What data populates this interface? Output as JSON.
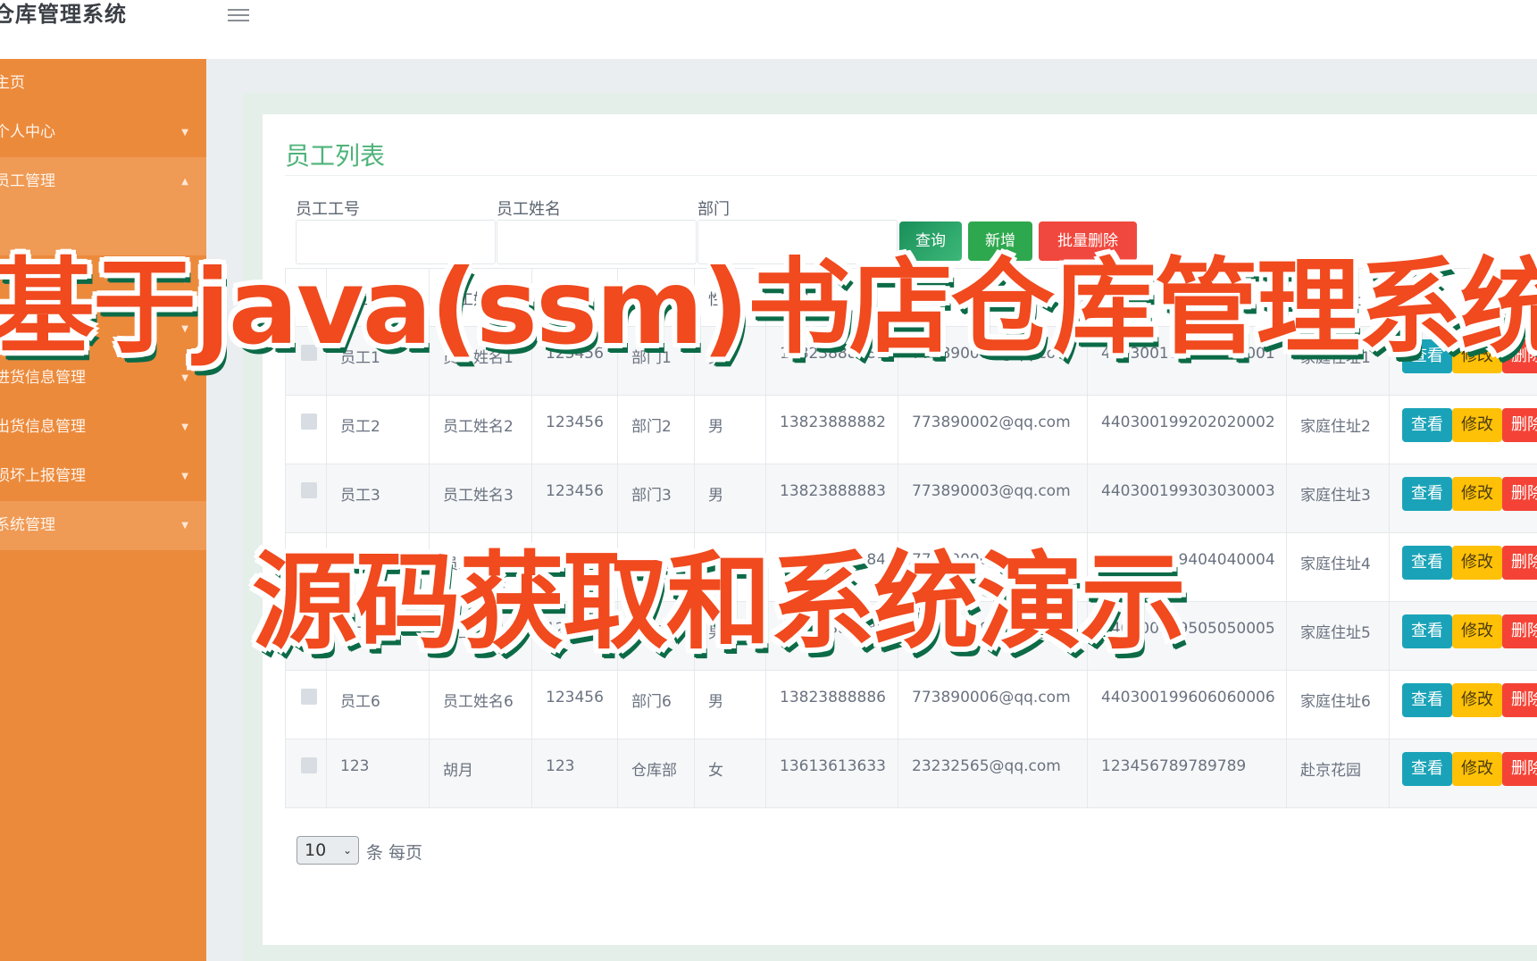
{
  "app": {
    "title": "仓库管理系统",
    "menu_icon": "hamburger-icon"
  },
  "sidebar": {
    "items": [
      {
        "label": "主页",
        "caret": ""
      },
      {
        "label": "个人中心",
        "caret": "▼"
      },
      {
        "label": "员工管理",
        "caret": "▲",
        "active": true
      },
      {
        "label": "",
        "caret": ""
      },
      {
        "label": "",
        "caret": "▼"
      },
      {
        "label": "供应商管理",
        "caret": "▼"
      },
      {
        "label": "进货信息管理",
        "caret": "▼"
      },
      {
        "label": "出货信息管理",
        "caret": "▼"
      },
      {
        "label": "损坏上报管理",
        "caret": "▼"
      },
      {
        "label": "系统管理",
        "caret": "▼"
      }
    ]
  },
  "page": {
    "title": "员工列表",
    "search": {
      "fields": [
        {
          "label": "员工工号",
          "value": "",
          "placeholder": ""
        },
        {
          "label": "员工姓名",
          "value": "",
          "placeholder": ""
        },
        {
          "label": "部门",
          "value": "",
          "placeholder": ""
        }
      ],
      "search_label": "查询",
      "add_label": "新增",
      "batch_delete_label": "批量删除"
    },
    "table": {
      "columns": [
        "",
        "员工工号",
        "员工姓名",
        "密码",
        "部门",
        "性别",
        "手机",
        "邮箱",
        "身份证",
        "家庭住址",
        "操作"
      ],
      "rows": [
        [
          "员工1",
          "员工姓名1",
          "123456",
          "部门1",
          "男",
          "13823888881",
          "773890001@qq.com",
          "440300199101010001",
          "家庭住址1"
        ],
        [
          "员工2",
          "员工姓名2",
          "123456",
          "部门2",
          "男",
          "13823888882",
          "773890002@qq.com",
          "440300199202020002",
          "家庭住址2"
        ],
        [
          "员工3",
          "员工姓名3",
          "123456",
          "部门3",
          "男",
          "13823888883",
          "773890003@qq.com",
          "440300199303030003",
          "家庭住址3"
        ],
        [
          "员工4",
          "员工姓名4",
          "123456",
          "部门4",
          "男",
          "13823888884",
          "773890004@qq.com",
          "440300199404040004",
          "家庭住址4"
        ],
        [
          "员工5",
          "员工姓名5",
          "123456",
          "部门5",
          "男",
          "13823888885",
          "773890005@qq.com",
          "440300199505050005",
          "家庭住址5"
        ],
        [
          "员工6",
          "员工姓名6",
          "123456",
          "部门6",
          "男",
          "13823888886",
          "773890006@qq.com",
          "440300199606060006",
          "家庭住址6"
        ],
        [
          "123",
          "胡月",
          "123",
          "仓库部",
          "女",
          "13613613633",
          "23232565@qq.com",
          "123456789789789",
          "赴京花园"
        ]
      ],
      "actions": {
        "view": "查看",
        "edit": "修改",
        "delete": "删除"
      }
    },
    "pager": {
      "page_size": "10",
      "label": "条 每页"
    }
  },
  "overlay": {
    "line1": "基于java(ssm)书店仓库管理系统",
    "line2": "源码获取和系统演示"
  },
  "colors": {
    "sidebar": "#ec8a3c",
    "title_green": "#4fb37a",
    "view": "#1aa3b8",
    "edit": "#ffc107",
    "delete": "#f44336",
    "overlay_text": "#f04a1e"
  }
}
